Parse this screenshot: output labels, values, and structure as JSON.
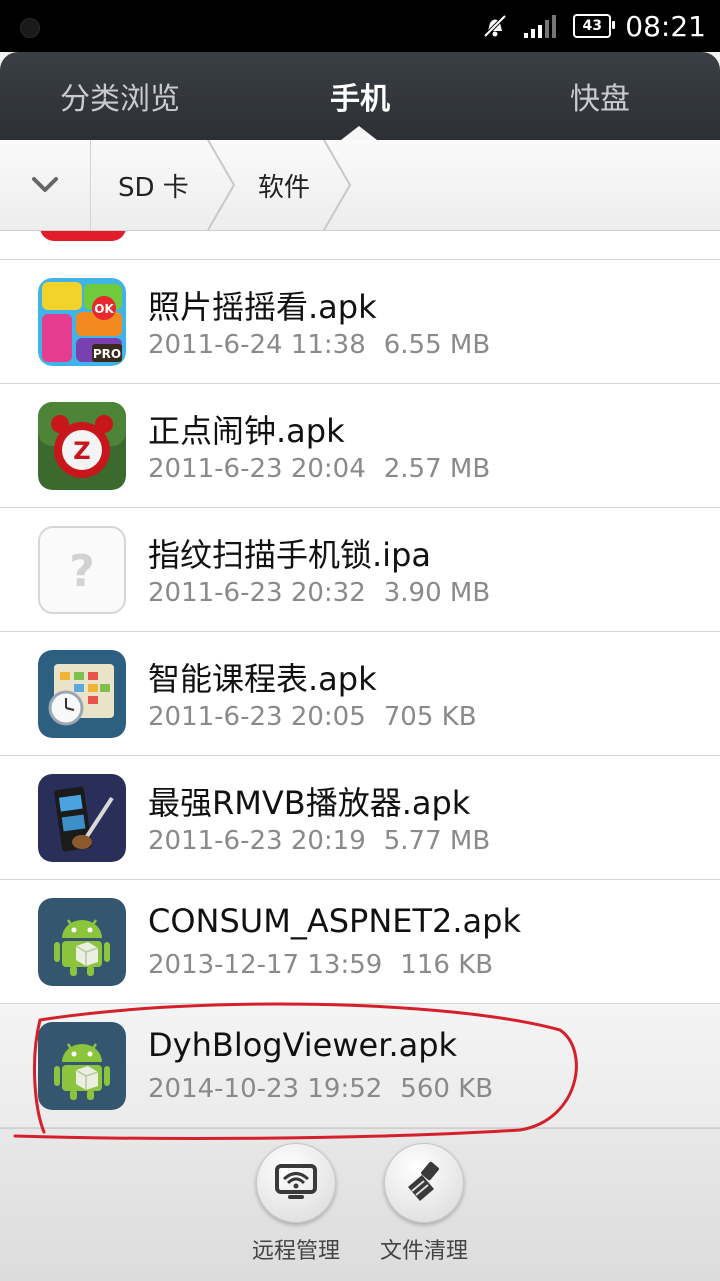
{
  "statusbar": {
    "battery": "43",
    "time": "08:21"
  },
  "tabs": [
    {
      "label": "分类浏览",
      "active": false
    },
    {
      "label": "手机",
      "active": true
    },
    {
      "label": "快盘",
      "active": false
    }
  ],
  "breadcrumb": {
    "root": "SD 卡",
    "current": "软件"
  },
  "files": [
    {
      "name": "照片摇摇看.apk",
      "date": "2011-6-24 11:38",
      "size": "6.55 MB",
      "icon": "photo-shake-app-icon"
    },
    {
      "name": "正点闹钟.apk",
      "date": "2011-6-23 20:04",
      "size": "2.57 MB",
      "icon": "alarm-clock-app-icon"
    },
    {
      "name": "指纹扫描手机锁.ipa",
      "date": "2011-6-23 20:32",
      "size": "3.90 MB",
      "icon": "unknown-file-icon"
    },
    {
      "name": "智能课程表.apk",
      "date": "2011-6-23 20:05",
      "size": "705 KB",
      "icon": "schedule-app-icon"
    },
    {
      "name": "最强RMVB播放器.apk",
      "date": "2011-6-23 20:19",
      "size": "5.77 MB",
      "icon": "video-player-app-icon"
    },
    {
      "name": "CONSUM_ASPNET2.apk",
      "date": "2013-12-17 13:59",
      "size": "116 KB",
      "icon": "android-apk-icon"
    },
    {
      "name": "DyhBlogViewer.apk",
      "date": "2014-10-23 19:52",
      "size": "560 KB",
      "icon": "android-apk-icon",
      "selected": true
    }
  ],
  "actions": [
    {
      "label": "远程管理",
      "icon": "remote-manage-icon"
    },
    {
      "label": "文件清理",
      "icon": "file-clean-icon"
    }
  ],
  "colors": {
    "annotation": "#d4202a",
    "tabbar": "#2f3338"
  }
}
